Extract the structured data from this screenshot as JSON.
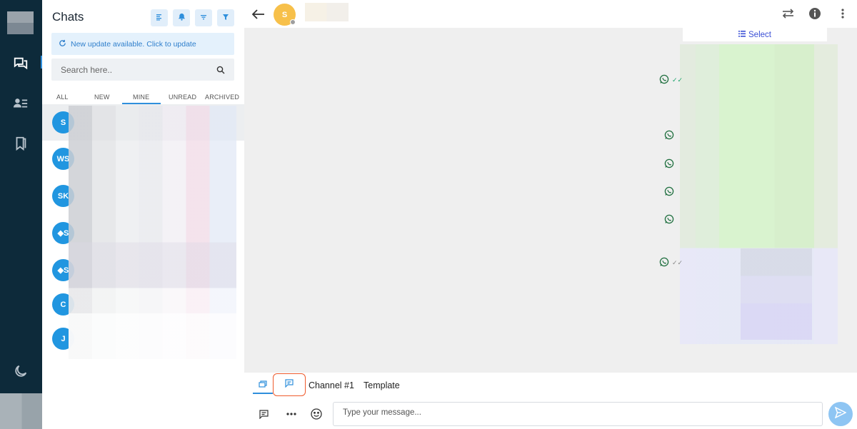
{
  "sidebar": {
    "items": [
      {
        "name": "chats",
        "icon": "chat-bubbles-icon",
        "active": true
      },
      {
        "name": "contacts",
        "icon": "contacts-icon",
        "active": false
      },
      {
        "name": "saved",
        "icon": "bookmarks-icon",
        "active": false
      }
    ],
    "theme_icon": "moon-icon"
  },
  "chats_panel": {
    "title": "Chats",
    "tools": [
      "list-icon",
      "bell-icon",
      "sort-icon",
      "filter-icon"
    ],
    "update_banner": "New update available. Click to update",
    "search_placeholder": "Search here..",
    "tabs": [
      "ALL",
      "NEW",
      "MINE",
      "UNREAD",
      "ARCHIVED"
    ],
    "active_tab": "MINE",
    "chats": [
      {
        "initials": "S",
        "selected": true
      },
      {
        "initials": "WS",
        "selected": false
      },
      {
        "initials": "SK",
        "selected": false
      },
      {
        "initials": "◆S",
        "selected": false
      },
      {
        "initials": "◆S",
        "selected": false
      },
      {
        "initials": "C",
        "selected": false
      },
      {
        "initials": "J",
        "selected": false
      }
    ]
  },
  "conversation": {
    "contact_initial": "S",
    "select_label": "Select",
    "composer": {
      "channel_label": "Channel #1",
      "template_label": "Template",
      "placeholder": "Type your message..."
    }
  },
  "colors": {
    "rail": "#0d2a3a",
    "accent": "#2f8fdc",
    "avatar": "#2196e0",
    "contact_avatar": "#f7c04a",
    "highlight_border": "#ef5b2d"
  }
}
